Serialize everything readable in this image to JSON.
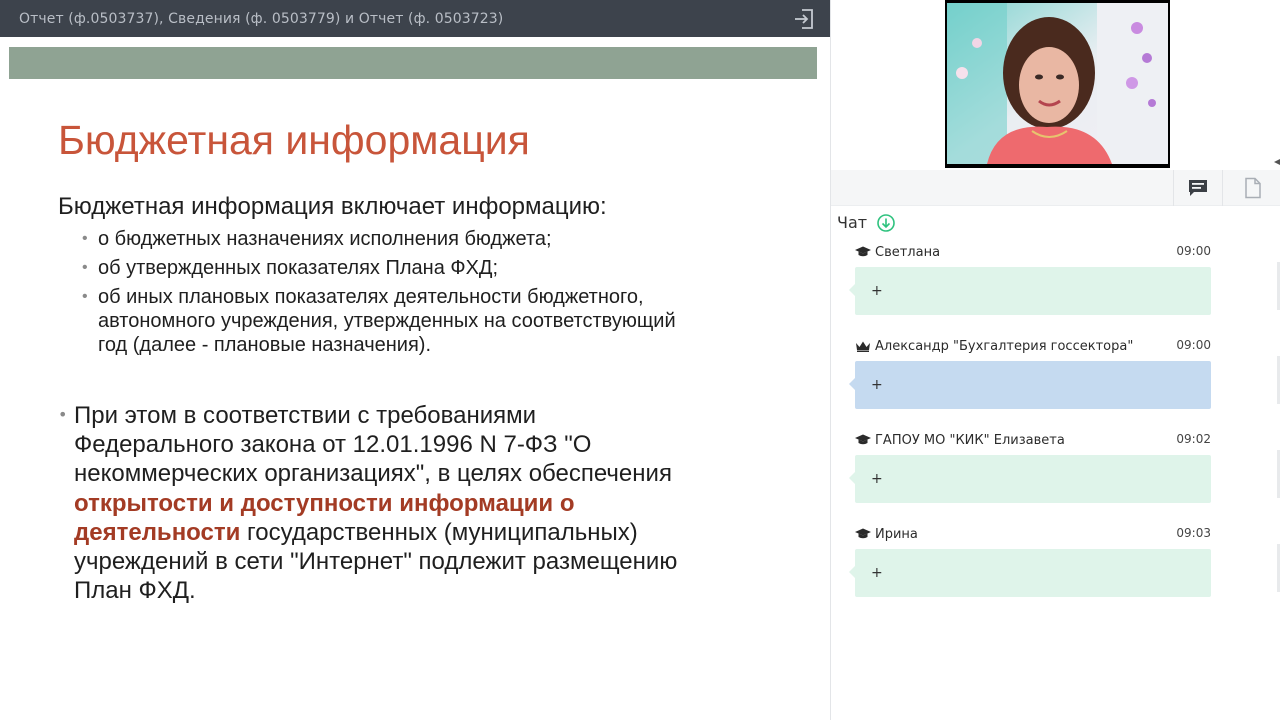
{
  "presentation": {
    "title": "Отчет (ф.0503737), Сведения (ф. 0503779) и Отчет (ф. 0503723)",
    "slide": {
      "heading": "Бюджетная информация",
      "intro": "Бюджетная информация включает информацию:",
      "sub_items": [
        "о бюджетных назначениях исполнения бюджета;",
        "об утвержденных показателях Плана ФХД;",
        "об иных плановых показателях деятельности бюджетного,\nавтономного учреждения, утвержденных на соответствующий\nгод (далее - плановые назначения)."
      ],
      "main_bullet": {
        "before": "При этом в соответствии с требованиями\nФедерального закона от 12.01.1996 N 7-ФЗ \"О\nнекоммерческих организациях\", в целях обеспечения\n",
        "accent": "открытости и доступности информации о\nдеятельности",
        "after": " государственных (муниципальных)\nучреждений в сети \"Интернет\" подлежит размещению\nПлан ФХД."
      }
    }
  },
  "chat": {
    "title": "Чат",
    "messages": [
      {
        "author": "Светлана",
        "time": "09:00",
        "text": "+",
        "role": "student"
      },
      {
        "author": "Александр \"Бухгалтерия госсектора\"",
        "time": "09:00",
        "text": "+",
        "role": "host"
      },
      {
        "author": "ГАПОУ МО \"КИК\" Елизавета",
        "time": "09:02",
        "text": "+",
        "role": "student"
      },
      {
        "author": "Ирина",
        "time": "09:03",
        "text": "+",
        "role": "student"
      }
    ]
  },
  "icons": {
    "exit": "exit-icon",
    "chat_tab": "chat-bubble-icon",
    "document_tab": "document-icon",
    "scroll_down": "arrow-down-circle-icon",
    "student": "graduation-cap-icon",
    "host": "crown-icon"
  },
  "colors": {
    "slide_heading": "#c8553a",
    "slide_accent": "#a33b24",
    "topbar": "#3d434c",
    "bubble_student": "#dff4ea",
    "bubble_host": "#c5daf0",
    "chat_down_icon": "#2ec27e"
  }
}
